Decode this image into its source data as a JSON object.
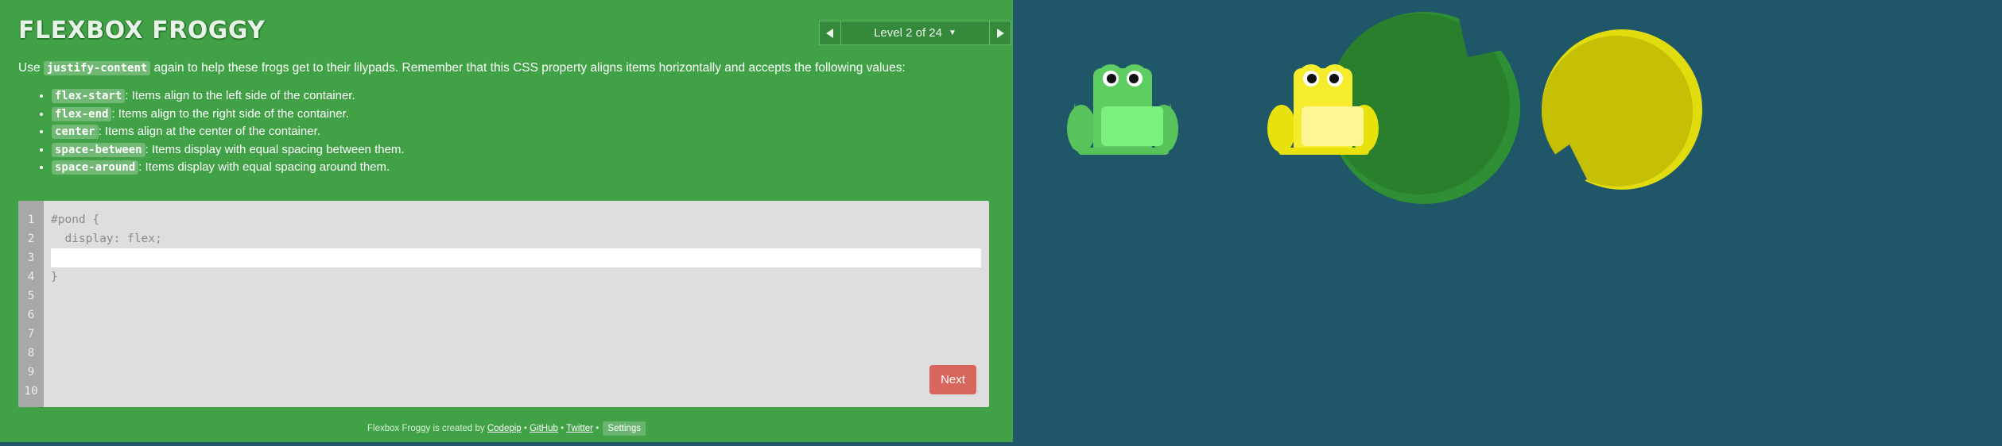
{
  "app": {
    "title": "FLEXBOX FROGGY",
    "level_label": "Level 2 of 24",
    "prev_icon": "triangle-left-icon",
    "next_icon": "triangle-right-icon"
  },
  "instructions": {
    "before": "Use ",
    "property": "justify-content",
    "after": " again to help these frogs get to their lilypads. Remember that this CSS property aligns items horizontally and accepts the following values:",
    "values": [
      {
        "keyword": "flex-start",
        "desc": ": Items align to the left side of the container."
      },
      {
        "keyword": "flex-end",
        "desc": ": Items align to the right side of the container."
      },
      {
        "keyword": "center",
        "desc": ": Items align at the center of the container."
      },
      {
        "keyword": "space-between",
        "desc": ": Items display with equal spacing between them."
      },
      {
        "keyword": "space-around",
        "desc": ": Items display with equal spacing around them."
      }
    ]
  },
  "editor": {
    "line_numbers": [
      "1",
      "2",
      "3",
      "4",
      "5",
      "6",
      "7",
      "8",
      "9",
      "10"
    ],
    "line1": "#pond {",
    "line2": "  display: flex;",
    "input_value": "",
    "line4": "}",
    "next_label": "Next"
  },
  "footer": {
    "prefix": "Flexbox Froggy is created by ",
    "codepip": "Codepip",
    "sep": " • ",
    "github": "GitHub",
    "twitter": "Twitter",
    "settings": "Settings"
  },
  "colors": {
    "sidebar_bg": "#40a146",
    "pond_bg": "#1f5768",
    "green_frog": "#5ccb5f",
    "yellow_frog": "#f1e02a",
    "green_lilypad": "#2c8a2f",
    "yellow_lilypad": "#c5c105",
    "next_button": "#d9665d"
  },
  "pond": {
    "frogs": [
      {
        "color": "green",
        "icon": "green-frog-icon"
      },
      {
        "color": "yellow",
        "icon": "yellow-frog-icon"
      }
    ],
    "lilypads": [
      {
        "color": "green",
        "icon": "green-lilypad-icon"
      },
      {
        "color": "yellow",
        "icon": "yellow-lilypad-icon"
      }
    ]
  }
}
